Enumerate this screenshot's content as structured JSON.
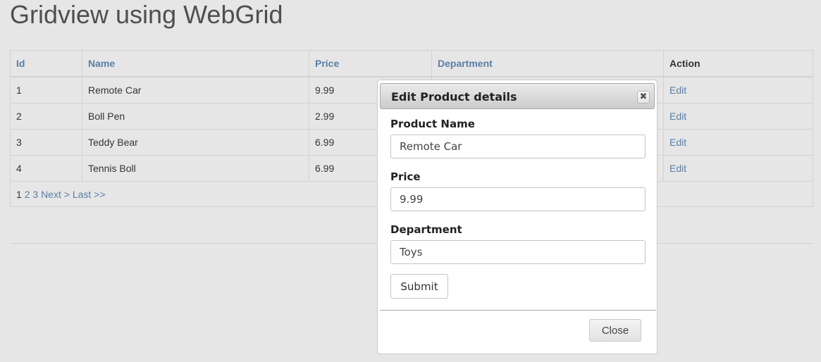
{
  "page": {
    "title": "Gridview using WebGrid"
  },
  "grid": {
    "columns": [
      "Id",
      "Name",
      "Price",
      "Department",
      "Action"
    ],
    "rows": [
      {
        "id": "1",
        "name": "Remote Car",
        "price": "9.99",
        "department": "",
        "action": "Edit"
      },
      {
        "id": "2",
        "name": "Boll Pen",
        "price": "2.99",
        "department": "",
        "action": "Edit"
      },
      {
        "id": "3",
        "name": "Teddy Bear",
        "price": "6.99",
        "department": "",
        "action": "Edit"
      },
      {
        "id": "4",
        "name": "Tennis Boll",
        "price": "6.99",
        "department": "",
        "action": "Edit"
      }
    ],
    "pager": {
      "current": "1",
      "pages": [
        "2",
        "3"
      ],
      "next": "Next >",
      "last": "Last >>"
    }
  },
  "dialog": {
    "title": "Edit Product details",
    "close_icon_glyph": "✖",
    "fields": {
      "product_name": {
        "label": "Product Name",
        "value": "Remote Car"
      },
      "price": {
        "label": "Price",
        "value": "9.99"
      },
      "department": {
        "label": "Department",
        "value": "Toys"
      }
    },
    "submit_label": "Submit",
    "close_label": "Close"
  },
  "colors": {
    "link": "#5a7fa6",
    "background": "#e6e6e6",
    "dialog_background": "#ffffff"
  }
}
